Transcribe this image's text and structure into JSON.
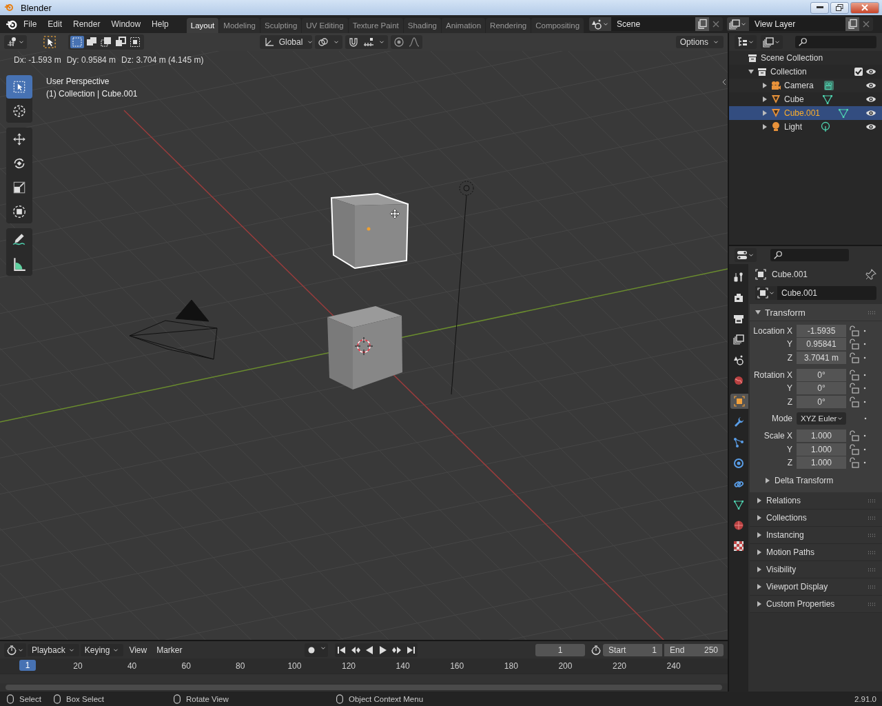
{
  "window": {
    "title": "Blender"
  },
  "menu": [
    "File",
    "Edit",
    "Render",
    "Window",
    "Help"
  ],
  "workspaces": [
    {
      "label": "Layout",
      "selected": true
    },
    {
      "label": "Modeling",
      "selected": false
    },
    {
      "label": "Sculpting",
      "selected": false
    },
    {
      "label": "UV Editing",
      "selected": false
    },
    {
      "label": "Texture Paint",
      "selected": false
    },
    {
      "label": "Shading",
      "selected": false
    },
    {
      "label": "Animation",
      "selected": false
    },
    {
      "label": "Rendering",
      "selected": false
    },
    {
      "label": "Compositing",
      "selected": false
    }
  ],
  "scene": {
    "name": "Scene"
  },
  "view_layer": {
    "name": "View Layer"
  },
  "viewport": {
    "select_modes": [
      {
        "selected": true
      },
      {
        "selected": false
      },
      {
        "selected": false
      },
      {
        "selected": false
      },
      {
        "selected": false
      }
    ],
    "orientation": "Global",
    "options": "Options",
    "operator_info": [
      "Dx: -1.593 m",
      "Dy: 0.9584 m",
      "Dz: 3.704 m (4.145 m)"
    ],
    "view_name": "User Perspective",
    "view_info": "(1) Collection | Cube.001",
    "tools": [
      {
        "kind": "select-box",
        "selected": true
      },
      {
        "kind": "cursor",
        "selected": false
      },
      {
        "kind": "move",
        "selected": false
      },
      {
        "kind": "rotate",
        "selected": false
      },
      {
        "kind": "scale",
        "selected": false
      },
      {
        "kind": "transform",
        "selected": false
      },
      {
        "kind": "annotate",
        "selected": false
      },
      {
        "kind": "measure",
        "selected": false
      }
    ]
  },
  "outliner": {
    "root": "Scene Collection",
    "items": [
      {
        "kind": "collection",
        "label": "Collection",
        "expanded": true,
        "checked": true,
        "selected": false,
        "children": [
          {
            "kind": "camera",
            "label": "Camera",
            "expanded": false,
            "selected": false
          },
          {
            "kind": "mesh",
            "label": "Cube",
            "expanded": false,
            "selected": false
          },
          {
            "kind": "mesh",
            "label": "Cube.001",
            "expanded": false,
            "selected": true
          },
          {
            "kind": "light",
            "label": "Light",
            "expanded": false,
            "selected": false
          }
        ]
      }
    ]
  },
  "properties": {
    "tabs": [
      {
        "kind": "tool",
        "selected": false
      },
      {
        "kind": "render",
        "selected": false
      },
      {
        "kind": "output",
        "selected": false
      },
      {
        "kind": "view-layer",
        "selected": false
      },
      {
        "kind": "scene",
        "selected": false
      },
      {
        "kind": "world",
        "selected": false
      },
      {
        "kind": "object",
        "selected": true
      },
      {
        "kind": "modifiers",
        "selected": false
      },
      {
        "kind": "particles",
        "selected": false
      },
      {
        "kind": "physics",
        "selected": false
      },
      {
        "kind": "constraints",
        "selected": false
      },
      {
        "kind": "data",
        "selected": false
      },
      {
        "kind": "material",
        "selected": false
      },
      {
        "kind": "texture",
        "selected": false
      }
    ],
    "object_name": "Cube.001",
    "datablock": "Cube.001",
    "panels": [
      {
        "title": "Transform",
        "expanded": true,
        "groups": [
          {
            "rows": [
              {
                "kind": "number",
                "label": "Location X",
                "value": "-1.5935"
              },
              {
                "kind": "number",
                "label": "Y",
                "value": "0.95841"
              },
              {
                "kind": "number",
                "label": "Z",
                "value": "3.7041 m"
              }
            ]
          },
          {
            "rows": [
              {
                "kind": "number",
                "label": "Rotation X",
                "value": "0°"
              },
              {
                "kind": "number",
                "label": "Y",
                "value": "0°"
              },
              {
                "kind": "number",
                "label": "Z",
                "value": "0°"
              }
            ]
          },
          {
            "rows": [
              {
                "kind": "dropdown",
                "label": "Mode",
                "value": "XYZ Euler"
              }
            ]
          },
          {
            "rows": [
              {
                "kind": "number",
                "label": "Scale X",
                "value": "1.000"
              },
              {
                "kind": "number",
                "label": "Y",
                "value": "1.000"
              },
              {
                "kind": "number",
                "label": "Z",
                "value": "1.000"
              }
            ]
          }
        ],
        "subpanels": [
          {
            "title": "Delta Transform",
            "expanded": false
          }
        ]
      },
      {
        "title": "Relations",
        "expanded": false
      },
      {
        "title": "Collections",
        "expanded": false
      },
      {
        "title": "Instancing",
        "expanded": false
      },
      {
        "title": "Motion Paths",
        "expanded": false
      },
      {
        "title": "Visibility",
        "expanded": false
      },
      {
        "title": "Viewport Display",
        "expanded": false
      },
      {
        "title": "Custom Properties",
        "expanded": false
      }
    ]
  },
  "timeline": {
    "menus": [
      {
        "label": "Playback",
        "kind": "dropdown"
      },
      {
        "label": "Keying",
        "kind": "dropdown"
      },
      {
        "label": "View",
        "kind": "menu"
      },
      {
        "label": "Marker",
        "kind": "menu"
      }
    ],
    "current_frame": "1",
    "start": {
      "label": "Start",
      "value": "1"
    },
    "end": {
      "label": "End",
      "value": "250"
    },
    "playhead": "1",
    "ticks": [
      "20",
      "40",
      "60",
      "80",
      "100",
      "120",
      "140",
      "160",
      "180",
      "200",
      "220",
      "240"
    ]
  },
  "status_bar": {
    "hints": [
      {
        "kind": "left-click",
        "label": "Select"
      },
      {
        "kind": "drag",
        "label": "Box Select"
      },
      {
        "kind": "middle-click",
        "label": "Rotate View"
      },
      {
        "kind": "right-click",
        "label": "Object Context Menu"
      }
    ],
    "version": "2.91.0"
  }
}
